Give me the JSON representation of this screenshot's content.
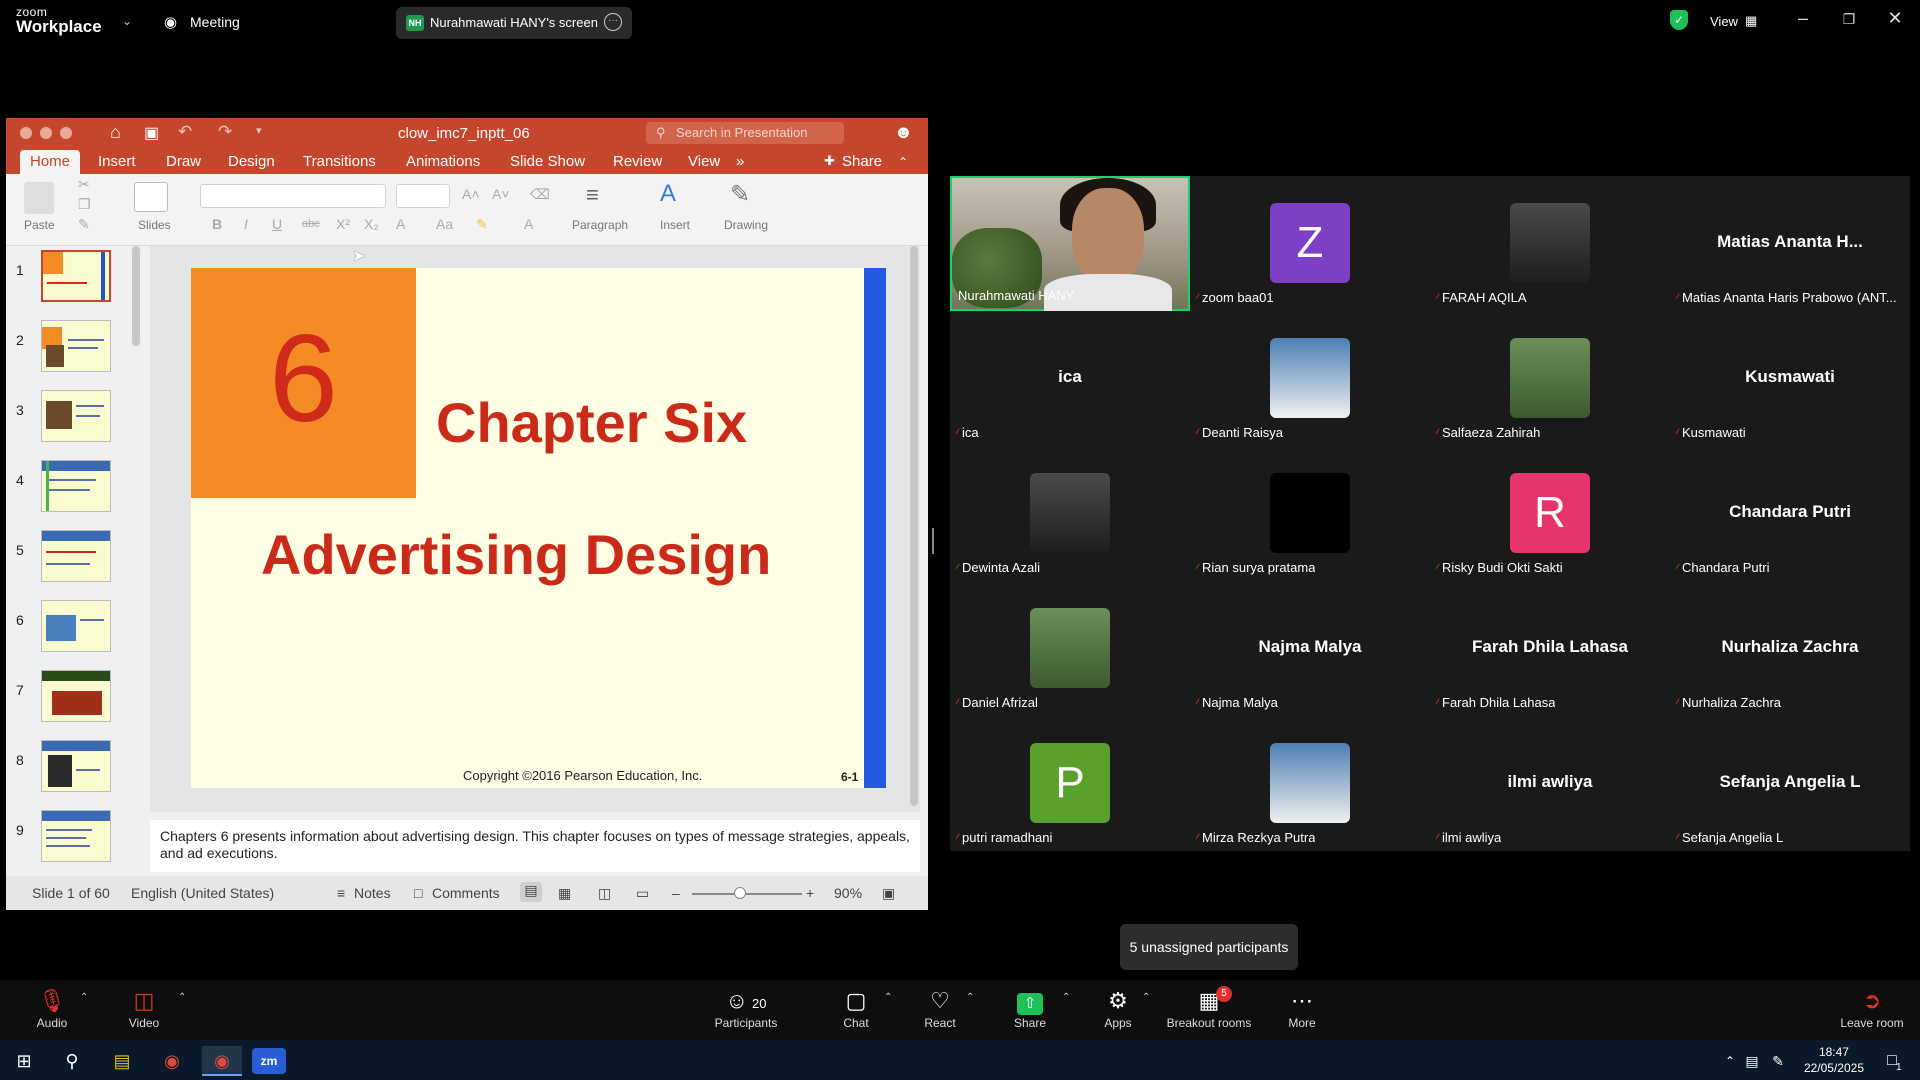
{
  "zoom": {
    "logo_line1": "zoom",
    "logo_line2": "Workplace",
    "meeting_label": "Meeting",
    "share_initials": "NH",
    "share_label": "Nurahmawati HANY's screen",
    "view_label": "View"
  },
  "ppt": {
    "filename": "clow_imc7_inptt_06",
    "search_placeholder": "Search in Presentation",
    "share_label": "Share",
    "tabs": [
      "Home",
      "Insert",
      "Draw",
      "Design",
      "Transitions",
      "Animations",
      "Slide Show",
      "Review",
      "View"
    ],
    "ribbon": {
      "paste": "Paste",
      "slides": "Slides",
      "paragraph": "Paragraph",
      "insert": "Insert",
      "drawing": "Drawing"
    },
    "thumb_numbers": [
      "1",
      "2",
      "3",
      "4",
      "5",
      "6",
      "7",
      "8",
      "9"
    ],
    "slide": {
      "number": "6",
      "chapter": "Chapter Six",
      "title": "Advertising Design",
      "copyright": "Copyright ©2016 Pearson Education, Inc.",
      "page": "6-1"
    },
    "notes": "Chapters 6 presents information about advertising design. This chapter focuses on types of message strategies, appeals, and ad executions.",
    "status": {
      "slide_counter": "Slide 1 of 60",
      "language": "English (United States)",
      "notes": "Notes",
      "comments": "Comments",
      "zoom": "90%"
    }
  },
  "gallery": [
    {
      "name": "Nurahmawati HANY",
      "kind": "video",
      "muted": false
    },
    {
      "name": "zoom baa01",
      "kind": "letter",
      "letter": "Z",
      "color": "#7d3fc6",
      "muted": true
    },
    {
      "name": "FARAH AQILA",
      "kind": "photo",
      "muted": true
    },
    {
      "name": "Matias Ananta Haris Prabowo (ANT...",
      "kind": "text",
      "big": "Matias Ananta H...",
      "muted": true
    },
    {
      "name": "ica",
      "kind": "text",
      "big": "ica",
      "muted": true
    },
    {
      "name": "Deanti Raisya",
      "kind": "photo",
      "muted": true
    },
    {
      "name": "Salfaeza Zahirah",
      "kind": "photo",
      "muted": true
    },
    {
      "name": "Kusmawati",
      "kind": "text",
      "big": "Kusmawati",
      "muted": true
    },
    {
      "name": "Dewinta Azali",
      "kind": "photo",
      "muted": true
    },
    {
      "name": "Rian surya pratama",
      "kind": "black",
      "muted": true
    },
    {
      "name": "Risky Budi Okti Sakti",
      "kind": "letter",
      "letter": "R",
      "color": "#e8346d",
      "muted": true
    },
    {
      "name": "Chandara Putri",
      "kind": "text",
      "big": "Chandara Putri",
      "muted": true
    },
    {
      "name": "Daniel Afrizal",
      "kind": "photo",
      "muted": true
    },
    {
      "name": "Najma Malya",
      "kind": "text",
      "big": "Najma Malya",
      "muted": true
    },
    {
      "name": "Farah Dhila Lahasa",
      "kind": "text",
      "big": "Farah Dhila Lahasa",
      "muted": true
    },
    {
      "name": "Nurhaliza Zachra",
      "kind": "text",
      "big": "Nurhaliza Zachra",
      "muted": true
    },
    {
      "name": "putri ramadhani",
      "kind": "letter",
      "letter": "P",
      "color": "#5aa02c",
      "muted": true
    },
    {
      "name": "Mirza Rezkya Putra",
      "kind": "photo",
      "muted": true
    },
    {
      "name": "ilmi awliya",
      "kind": "text",
      "big": "ilmi awliya",
      "muted": true
    },
    {
      "name": "Sefanja Angelia L",
      "kind": "text",
      "big": "Sefanja Angelia L",
      "muted": true
    }
  ],
  "tooltip": "5 unassigned participants",
  "toolbar": {
    "audio": "Audio",
    "video": "Video",
    "participants": "Participants",
    "participants_count": "20",
    "chat": "Chat",
    "react": "React",
    "share": "Share",
    "apps": "Apps",
    "breakout": "Breakout rooms",
    "breakout_badge": "5",
    "more": "More",
    "leave": "Leave room"
  },
  "taskbar": {
    "time": "18:47",
    "date": "22/05/2025",
    "notif_count": "1"
  }
}
